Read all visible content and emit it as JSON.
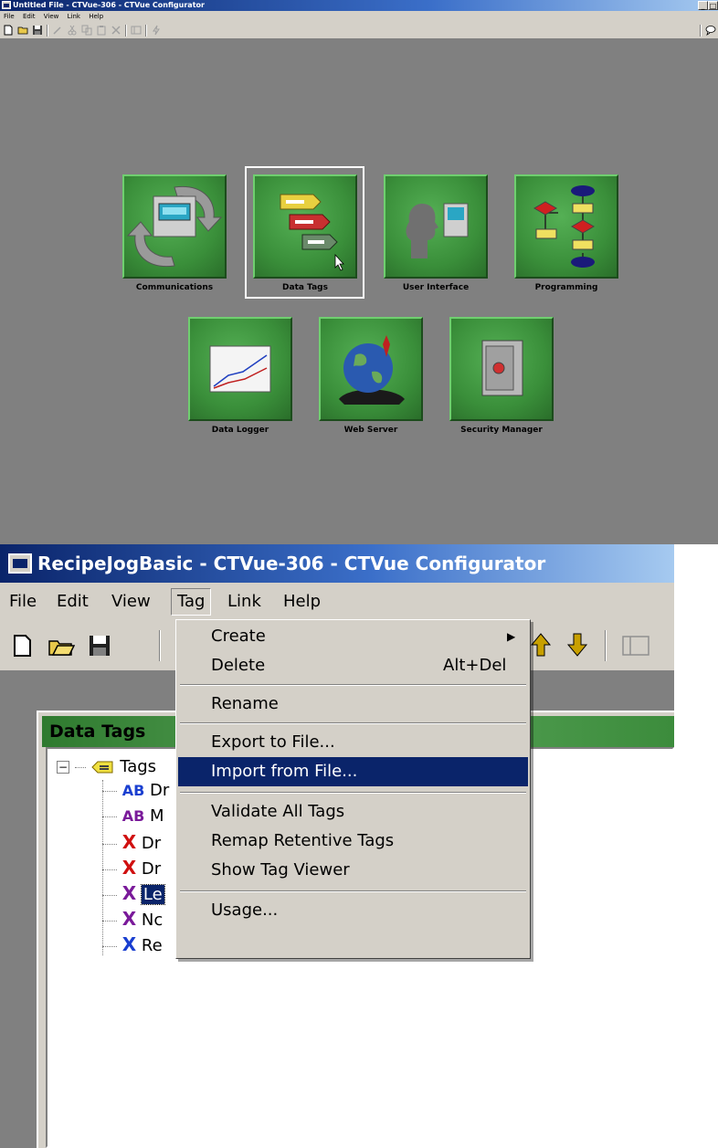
{
  "top_window": {
    "title": "Untitled File - CTVue-306 - CTVue Configurator",
    "title_buttons": {
      "minimize": "_",
      "maximize": "□"
    },
    "menu": [
      "File",
      "Edit",
      "View",
      "Link",
      "Help"
    ],
    "tiles": {
      "communications": "Communications",
      "data_tags": "Data Tags",
      "user_interface": "User Interface",
      "programming": "Programming",
      "data_logger": "Data Logger",
      "web_server": "Web Server",
      "security_manager": "Security Manager"
    },
    "selected_tile": "Data Tags",
    "colors": {
      "workspace": "#808080",
      "tile_green": "#3a8f3a",
      "titlebar": "#0a246a"
    }
  },
  "bottom_window": {
    "title": "RecipeJogBasic - CTVue-306 - CTVue Configurator",
    "menu": [
      "File",
      "Edit",
      "View",
      "Tag",
      "Link",
      "Help"
    ],
    "active_menu": "Tag",
    "panel_title": "Data Tags",
    "tree": {
      "root_label": "Tags",
      "expander": "⊟",
      "items": [
        {
          "icon": "AB",
          "text": "Dr",
          "color": "#1a3fd0"
        },
        {
          "icon": "AB",
          "text": "M",
          "color": "#7a1a9a"
        },
        {
          "icon": "X",
          "text": "Dr",
          "color": "#d01010"
        },
        {
          "icon": "X",
          "text": "Dr",
          "color": "#d01010"
        },
        {
          "icon": "X",
          "text": "Le",
          "color": "#7a1a9a"
        },
        {
          "icon": "X",
          "text": "Nc",
          "color": "#7a1a9a"
        },
        {
          "icon": "X",
          "text": "Re",
          "color": "#1a3fd0"
        }
      ]
    },
    "tag_menu": {
      "create": "Create",
      "create_arrow": "▶",
      "delete": "Delete",
      "delete_shortcut": "Alt+Del",
      "rename": "Rename",
      "export": "Export to File...",
      "import": "Import from File...",
      "validate": "Validate All Tags",
      "remap": "Remap Retentive Tags",
      "viewer": "Show Tag Viewer",
      "usage": "Usage...",
      "highlighted": "Import from File..."
    },
    "colors": {
      "menu_bg": "#d4d0c8",
      "highlight": "#0a246a",
      "panel_header": "#3c8c3c",
      "toolbar_arrow": "#c8a000"
    }
  }
}
